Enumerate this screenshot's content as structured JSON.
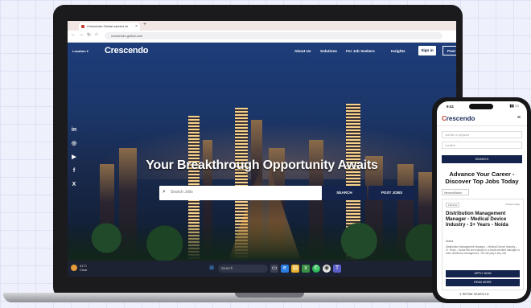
{
  "browser": {
    "tab_title": "Crescendo Global careers fo",
    "url": "crescendo-global.com"
  },
  "site": {
    "location_label": "Location",
    "logo": "Crescendo",
    "nav": [
      "About Us",
      "Solutions",
      "For Job Seekers",
      "Insights"
    ],
    "signin": "Sign in",
    "post_jobs": "Post Jobs",
    "social": [
      "in",
      "◎",
      "▶",
      "f",
      "X"
    ],
    "headline": "Your Breakthrough Opportunity Awaits",
    "search_placeholder": "Search Jobs",
    "search_button": "SEARCH",
    "post_jobs_button": "POST JOBS"
  },
  "taskbar": {
    "weather": "31°C",
    "weather_sub": "Clear",
    "search_placeholder": "Search"
  },
  "phone": {
    "time": "9:41",
    "logo_prefix": "C",
    "logo_rest": "rescendo",
    "input1_placeholder": "Job title or keyword",
    "input2_placeholder": "Location",
    "search_button": "SEARCH",
    "title": "Advance Your Career - Discover Top Jobs Today",
    "filter": "Newest/Match",
    "card": {
      "chip": "Full time",
      "date": "Posted today",
      "job_title": "Distribution Management Manager - Medical Device Industry - 3+ Years - Noida",
      "location": "Noida",
      "description": "Distribution Management Manager – Medical Device Industry – 3+ Years – Noida We are looking for a result-oriented manager to drive distributor management. You will play a key role",
      "apply": "APPLY NOW",
      "read_more": "READ MORE"
    },
    "refine": "REFINE SEARCH"
  }
}
